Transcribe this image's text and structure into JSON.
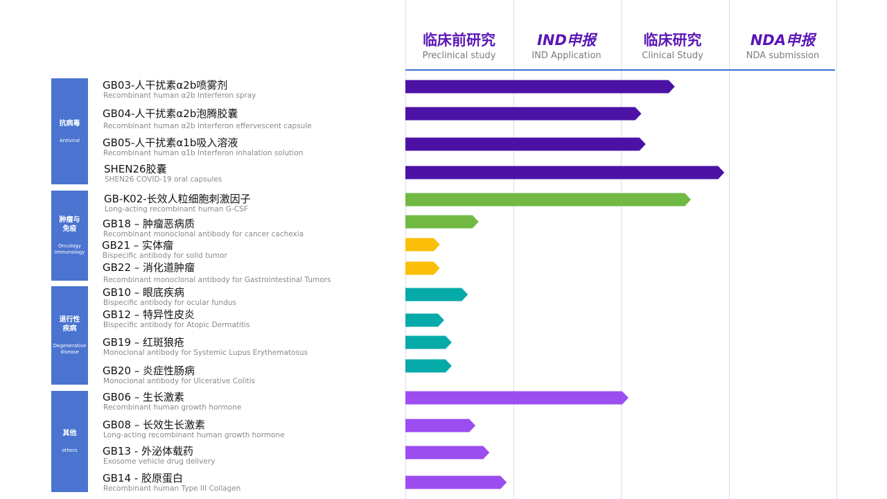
{
  "stage_headers": [
    {
      "cn": "临床前研究",
      "en": "Preclinical study",
      "italic": false
    },
    {
      "cn": "IND申报",
      "en": "IND Application",
      "italic": true
    },
    {
      "cn": "临床研究",
      "en": "Clinical Study",
      "italic": false
    },
    {
      "cn": "NDA申报",
      "en": "NDA submission",
      "italic": true
    }
  ],
  "categories": [
    {
      "cn": "抗病毒",
      "en": "Antiviral",
      "color": "#4a74cf"
    },
    {
      "cn": "肿瘤与免疫",
      "en": "Oncology Immunology",
      "color": "#4a74cf"
    },
    {
      "cn": "退行性疾病",
      "en": "Degenerative disease",
      "color": "#4a74cf"
    },
    {
      "cn": "其他",
      "en": "others",
      "color": "#4a74cf"
    }
  ],
  "drugs": [
    {
      "cn": "GB03-人干扰素α2b喷雾剂",
      "en": "Recombinant human α2b Interferon spray"
    },
    {
      "cn": "GB04-人干扰素α2b泡腾胶囊",
      "en": "Recombinant human α2b Interferon effervescent capsule"
    },
    {
      "cn": "GB05-人干扰素α1b吸入溶液",
      "en": "Recombinant human α1b Interferon inhalation solution"
    },
    {
      "cn": "SHEN26胶囊",
      "en": "SHEN26 COVID-19 oral capsules"
    },
    {
      "cn": "GB-K02-长效人粒细胞刺激因子",
      "en": "Long-acting  recombinant human G-CSF"
    },
    {
      "cn": "GB18 – 肿瘤恶病质",
      "en": "Recombinant monoclonal antibody for cancer cachexia"
    },
    {
      "cn": "GB21 – 实体瘤",
      "en": "Bispecific antibody for solid tumor"
    },
    {
      "cn": "GB22 – 消化道肿瘤",
      "en": "Recombinant monoclonal antibody for Gastrointestinal Tumors"
    },
    {
      "cn": "GB10 – 眼底疾病",
      "en": "Bispecific antibody for ocular fundus"
    },
    {
      "cn": "GB12 – 特异性皮炎",
      "en": "Bispecific antibody for Atopic Dermatitis"
    },
    {
      "cn": "GB19 – 红斑狼疮",
      "en": "Monoclonal antibody for Systemic Lupus Erythematosus"
    },
    {
      "cn": "GB20 – 炎症性肠病",
      "en": "Monoclonal antibody for Ulcerative Colitis"
    },
    {
      "cn": "GB06 – 生长激素",
      "en": "Recombinant human growth hormone"
    },
    {
      "cn": "GB08 – 长效生长激素",
      "en": "Long-acting recombinant human growth hormone"
    },
    {
      "cn": "GB13 - 外泌体载药",
      "en": "Exosome vehicle drug delivery"
    },
    {
      "cn": "GB14 - 胶原蛋白",
      "en": "Recombinant human Type III Collagen"
    }
  ],
  "chart_data": {
    "type": "bar",
    "orientation": "horizontal",
    "x_stages": [
      "临床前研究",
      "IND申报",
      "临床研究",
      "NDA申报"
    ],
    "xlim": [
      0,
      4
    ],
    "categories": [
      "GB03-人干扰素α2b喷雾剂",
      "GB04-人干扰素α2b泡腾胶囊",
      "GB05-人干扰素α1b吸入溶液",
      "SHEN26胶囊",
      "GB-K02-长效人粒细胞刺激因子",
      "GB18 – 肿瘤恶病质",
      "GB21 – 实体瘤",
      "GB22 – 消化道肿瘤",
      "GB10 – 眼底疾病",
      "GB12 – 特异性皮炎",
      "GB19 – 红斑狼疮",
      "GB20 – 炎症性肠病",
      "GB06 – 生长激素",
      "GB08 – 长效生长激素",
      "GB13 - 外泌体载药",
      "GB14 - 胶原蛋白"
    ],
    "values": [
      2.5,
      2.19,
      2.23,
      2.96,
      2.65,
      0.68,
      0.32,
      0.32,
      0.58,
      0.36,
      0.43,
      0.43,
      2.07,
      0.65,
      0.78,
      0.94
    ],
    "bar_colors": [
      "#4c12a6",
      "#4c12a6",
      "#4c12a6",
      "#4c12a6",
      "#72b944",
      "#72b944",
      "#fbbf0a",
      "#fbbf0a",
      "#06aaa8",
      "#06aaa8",
      "#06aaa8",
      "#06aaa8",
      "#9b4df0",
      "#9b4df0",
      "#9b4df0",
      "#9b4df0"
    ],
    "grid": true,
    "header_rule_color": "#3b6fd0",
    "grid_color": "#dcdcf0"
  }
}
